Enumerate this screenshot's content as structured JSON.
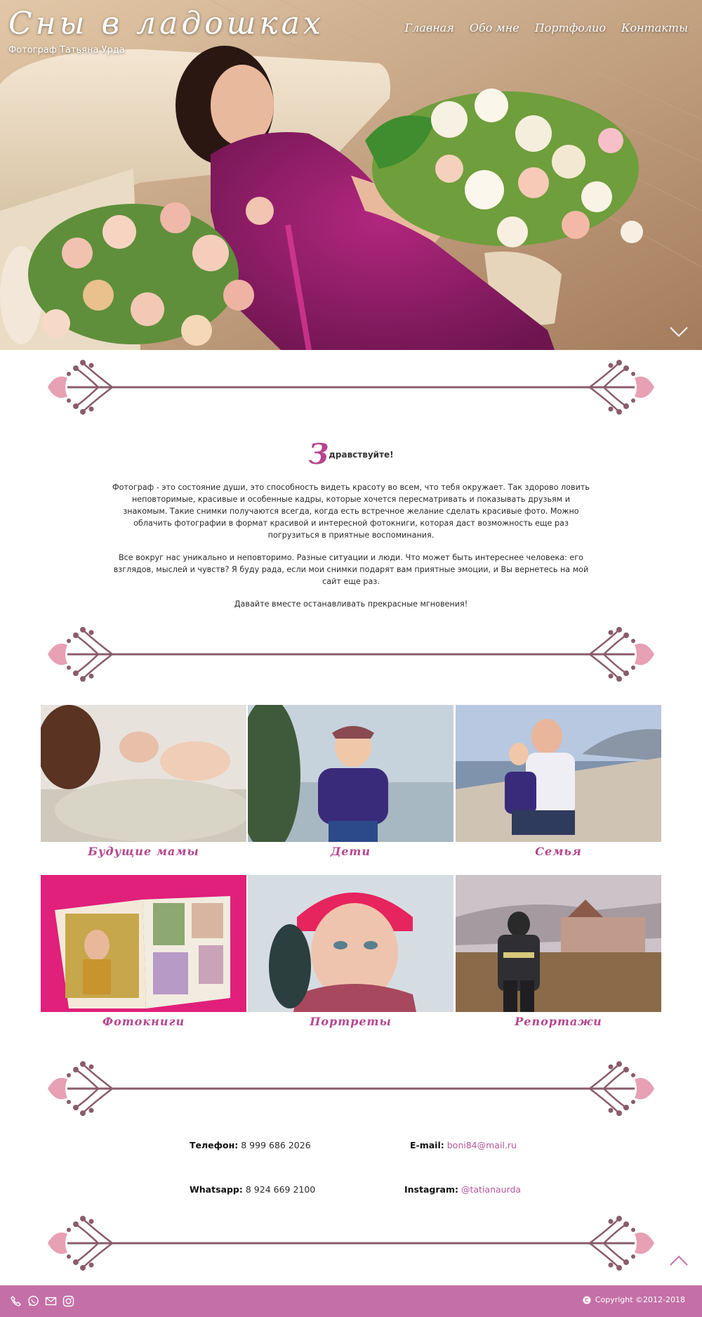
{
  "site": {
    "title": "Сны в ладошках",
    "subtitle": "Фотограф Татьяна Урда"
  },
  "nav": {
    "items": [
      {
        "label": "Главная"
      },
      {
        "label": "Обо мне"
      },
      {
        "label": "Портфолио"
      },
      {
        "label": "Контакты"
      }
    ]
  },
  "intro": {
    "greeting_letter": "З",
    "greeting_rest": "дравствуйте!",
    "paragraphs": [
      "Фотограф - это состояние души, это способность видеть красоту во всем, что тебя окружает. Так здорово ловить неповторимые, красивые и особенные кадры, которые хочется пересматривать и показывать друзьям и знакомым. Такие снимки получаются всегда, когда есть встречное желание сделать красивые фото. Можно облачить фотографии в формат красивой и интересной фотокниги, которая даст возможность еще раз погрузиться в приятные воспоминания.",
      "Все вокруг нас уникально и неповторимо. Разные ситуации и люди. Что может быть интереснее человека: его взглядов, мыслей и чувств? Я буду рада, если мои снимки подарят вам приятные эмоции, и Вы вернетесь на мой сайт еще раз.",
      "Давайте вместе останавливать прекрасные мгновения!"
    ]
  },
  "gallery": {
    "items": [
      {
        "caption": "Будущие мамы"
      },
      {
        "caption": "Дети"
      },
      {
        "caption": "Семья"
      },
      {
        "caption": "Фотокниги"
      },
      {
        "caption": "Портреты"
      },
      {
        "caption": "Репортажи"
      }
    ]
  },
  "contacts": {
    "phone_label": "Телефон:",
    "phone": "8 999 686 2026",
    "email_label": "E-mail:",
    "email": "boni84@mail.ru",
    "whatsapp_label": "Whatsapp:",
    "whatsapp": "8 924 669 2100",
    "instagram_label": "Instagram:",
    "instagram": "@tatianaurda"
  },
  "footer": {
    "copyright": "Copyright ©2012-2018",
    "icons": [
      "phone-icon",
      "whatsapp-icon",
      "mail-icon",
      "instagram-icon"
    ]
  },
  "colors": {
    "accent": "#b5468f",
    "footer_bg": "#c470a7",
    "ornament_line": "#8a5c6c",
    "ornament_flower": "#e7a0b4"
  }
}
